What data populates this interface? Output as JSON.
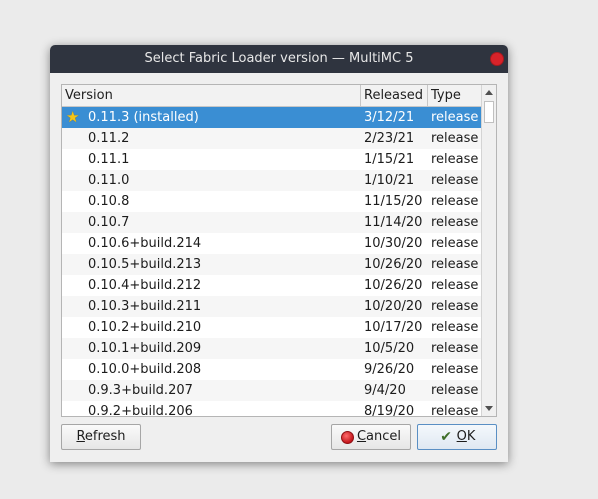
{
  "window": {
    "title": "Select Fabric Loader version — MultiMC 5"
  },
  "table": {
    "headers": {
      "version": "Version",
      "released": "Released",
      "type": "Type"
    },
    "rows": [
      {
        "version": "0.11.3 (installed)",
        "released": "3/12/21",
        "type": "release",
        "selected": true,
        "icon": "star-icon"
      },
      {
        "version": "0.11.2",
        "released": "2/23/21",
        "type": "release"
      },
      {
        "version": "0.11.1",
        "released": "1/15/21",
        "type": "release"
      },
      {
        "version": "0.11.0",
        "released": "1/10/21",
        "type": "release"
      },
      {
        "version": "0.10.8",
        "released": "11/15/20",
        "type": "release"
      },
      {
        "version": "0.10.7",
        "released": "11/14/20",
        "type": "release"
      },
      {
        "version": "0.10.6+build.214",
        "released": "10/30/20",
        "type": "release"
      },
      {
        "version": "0.10.5+build.213",
        "released": "10/26/20",
        "type": "release"
      },
      {
        "version": "0.10.4+build.212",
        "released": "10/26/20",
        "type": "release"
      },
      {
        "version": "0.10.3+build.211",
        "released": "10/20/20",
        "type": "release"
      },
      {
        "version": "0.10.2+build.210",
        "released": "10/17/20",
        "type": "release"
      },
      {
        "version": "0.10.1+build.209",
        "released": "10/5/20",
        "type": "release"
      },
      {
        "version": "0.10.0+build.208",
        "released": "9/26/20",
        "type": "release"
      },
      {
        "version": "0.9.3+build.207",
        "released": "9/4/20",
        "type": "release"
      },
      {
        "version": "0.9.2+build.206",
        "released": "8/19/20",
        "type": "release"
      }
    ]
  },
  "buttons": {
    "refresh": {
      "first": "R",
      "rest": "efresh"
    },
    "cancel": {
      "first": "C",
      "rest": "ancel"
    },
    "ok": {
      "first": "O",
      "rest": "K"
    }
  },
  "colors": {
    "titlebar": "#2f343f",
    "selection": "#3a8ed3",
    "close": "#d8232a"
  }
}
